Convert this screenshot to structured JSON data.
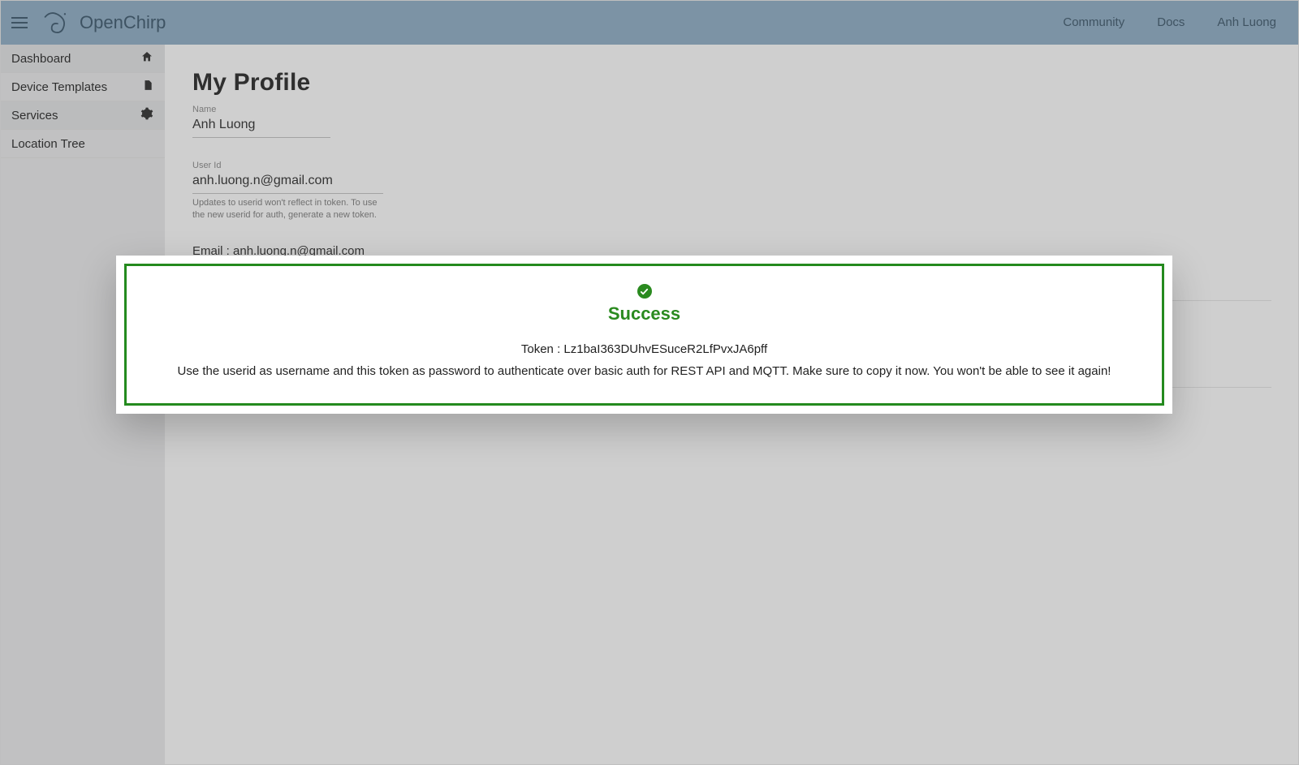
{
  "header": {
    "app_name": "OpenChirp",
    "links": {
      "community": "Community",
      "docs": "Docs",
      "user": "Anh Luong"
    }
  },
  "sidebar": {
    "items": [
      {
        "label": "Dashboard",
        "icon": "home-icon"
      },
      {
        "label": "Device Templates",
        "icon": "file-icon"
      },
      {
        "label": "Services",
        "icon": "gear-icon"
      },
      {
        "label": "Location Tree",
        "icon": ""
      }
    ]
  },
  "profile": {
    "title": "My Profile",
    "name_label": "Name",
    "name_value": "Anh Luong",
    "userid_label": "User Id",
    "userid_value": "anh.luong.n@gmail.com",
    "userid_hint": "Updates to userid won't reflect in token. To use the new userid for auth, generate a new token.",
    "email_prefix": "Email : ",
    "email_value": "anh.luong.n@gmail.com"
  },
  "modal": {
    "title": "Success",
    "token_prefix": "Token : ",
    "token_value": "Lz1baI363DUhvESuceR2LfPvxJA6pff",
    "message": "Use the userid as username and this token as password to authenticate over basic auth for REST API and MQTT. Make sure to copy it now. You won't be able to see it again!"
  },
  "colors": {
    "topbar": "#7e9cb3",
    "success": "#2a8a1f"
  }
}
